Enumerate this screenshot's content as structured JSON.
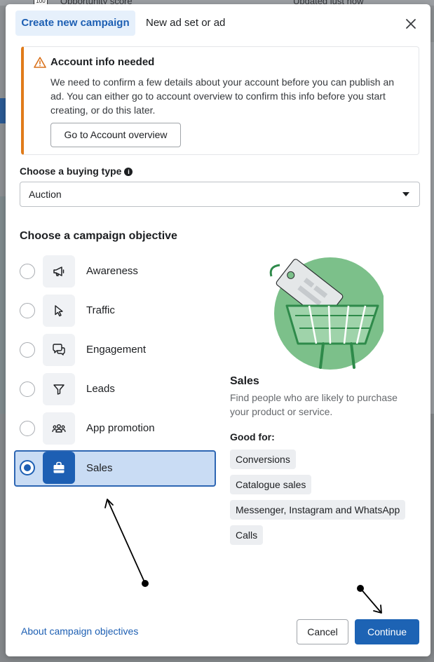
{
  "backdrop": {
    "opportunity_label": "Opportunity score",
    "opportunity_value": "100",
    "updated_label": "Updated just now"
  },
  "tabs": [
    {
      "label": "Create new campaign",
      "active": true
    },
    {
      "label": "New ad set or ad",
      "active": false
    }
  ],
  "alert": {
    "title": "Account info needed",
    "body": "We need to confirm a few details about your account before you can publish an ad. You can either go to account overview to confirm this info before you start creating, or do this later.",
    "button": "Go to Account overview",
    "accent_color": "#e07b1a"
  },
  "buying_type": {
    "label": "Choose a buying type",
    "value": "Auction"
  },
  "objectives": {
    "heading": "Choose a campaign objective",
    "items": [
      {
        "label": "Awareness",
        "icon": "megaphone-icon",
        "selected": false
      },
      {
        "label": "Traffic",
        "icon": "cursor-icon",
        "selected": false
      },
      {
        "label": "Engagement",
        "icon": "chat-bubbles-icon",
        "selected": false
      },
      {
        "label": "Leads",
        "icon": "filter-icon",
        "selected": false
      },
      {
        "label": "App promotion",
        "icon": "people-icon",
        "selected": false
      },
      {
        "label": "Sales",
        "icon": "shopping-bag-icon",
        "selected": true
      }
    ]
  },
  "selected_objective": {
    "title": "Sales",
    "description": "Find people who are likely to purchase your product or service.",
    "good_for_label": "Good for:",
    "good_for": [
      "Conversions",
      "Catalogue sales",
      "Messenger, Instagram and WhatsApp",
      "Calls"
    ]
  },
  "footer": {
    "about_link": "About campaign objectives",
    "cancel": "Cancel",
    "continue": "Continue"
  },
  "colors": {
    "primary": "#1d63b4",
    "selected_bg": "#c9dcf4",
    "illustration_green": "#7cc08a"
  }
}
